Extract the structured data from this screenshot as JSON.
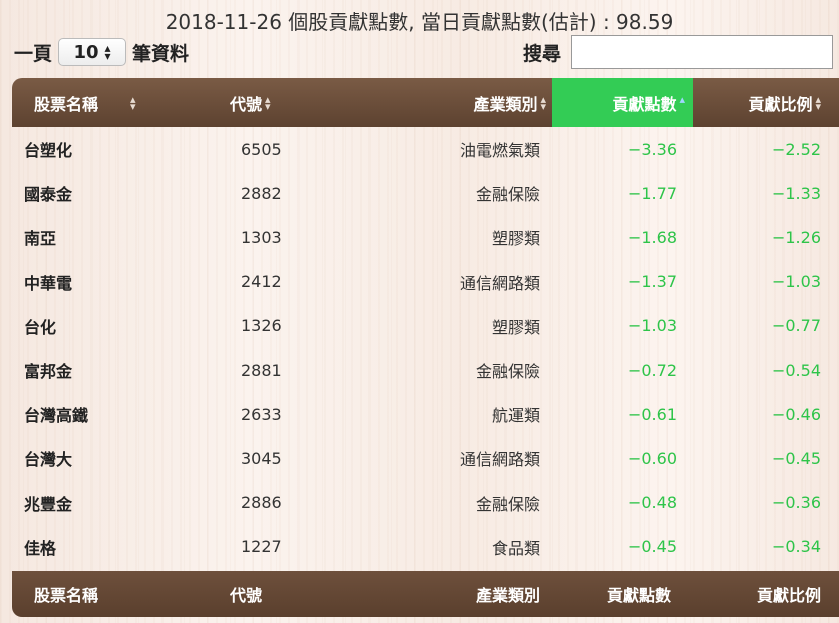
{
  "title": "2018-11-26 個股貢獻點數, 當日貢獻點數(估計) : 98.59",
  "pager": {
    "prefix": "一頁",
    "page_size": "10",
    "suffix": "筆資料"
  },
  "search": {
    "label": "搜尋",
    "value": ""
  },
  "colors": {
    "header_bg": "#6b4d39",
    "active_sort_bg": "#33cc55",
    "negative_value": "#2ec449"
  },
  "table": {
    "headers": [
      "股票名稱",
      "代號",
      "產業類別",
      "貢獻點數",
      "貢獻比例"
    ],
    "sorted_column": "貢獻點數",
    "rows": [
      {
        "name": "台塑化",
        "code": "6505",
        "industry": "油電燃氣類",
        "points": "−3.36",
        "ratio": "−2.52"
      },
      {
        "name": "國泰金",
        "code": "2882",
        "industry": "金融保險",
        "points": "−1.77",
        "ratio": "−1.33"
      },
      {
        "name": "南亞",
        "code": "1303",
        "industry": "塑膠類",
        "points": "−1.68",
        "ratio": "−1.26"
      },
      {
        "name": "中華電",
        "code": "2412",
        "industry": "通信網路類",
        "points": "−1.37",
        "ratio": "−1.03"
      },
      {
        "name": "台化",
        "code": "1326",
        "industry": "塑膠類",
        "points": "−1.03",
        "ratio": "−0.77"
      },
      {
        "name": "富邦金",
        "code": "2881",
        "industry": "金融保險",
        "points": "−0.72",
        "ratio": "−0.54"
      },
      {
        "name": "台灣高鐵",
        "code": "2633",
        "industry": "航運類",
        "points": "−0.61",
        "ratio": "−0.46"
      },
      {
        "name": "台灣大",
        "code": "3045",
        "industry": "通信網路類",
        "points": "−0.60",
        "ratio": "−0.45"
      },
      {
        "name": "兆豐金",
        "code": "2886",
        "industry": "金融保險",
        "points": "−0.48",
        "ratio": "−0.36"
      },
      {
        "name": "佳格",
        "code": "1227",
        "industry": "食品類",
        "points": "−0.45",
        "ratio": "−0.34"
      }
    ],
    "footers": [
      "股票名稱",
      "代號",
      "產業類別",
      "貢獻點數",
      "貢獻比例"
    ]
  }
}
